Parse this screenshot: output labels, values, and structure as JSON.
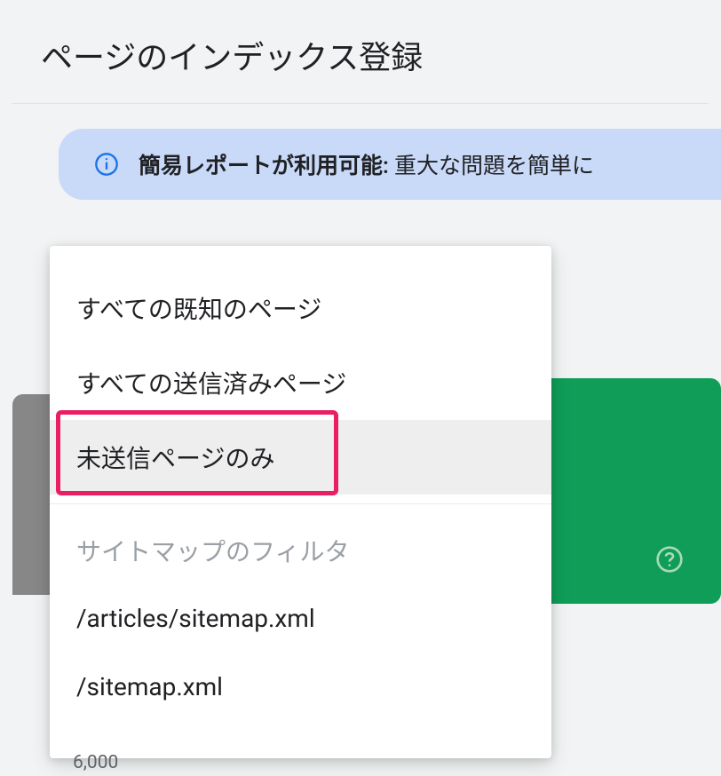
{
  "header": {
    "title": "ページのインデックス登録"
  },
  "banner": {
    "bold": "簡易レポートが利用可能:",
    "rest": " 重大な問題を簡単に"
  },
  "dropdown": {
    "items": [
      {
        "label": "すべての既知のページ",
        "selected": false
      },
      {
        "label": "すべての送信済みページ",
        "selected": false
      },
      {
        "label": "未送信ページのみ",
        "selected": true
      }
    ],
    "sectionLabel": "サイトマップのフィルタ",
    "sitemaps": [
      {
        "label": "/articles/sitemap.xml"
      },
      {
        "label": "/sitemap.xml"
      }
    ]
  },
  "chart": {
    "axisLabel": "6,000"
  },
  "colors": {
    "accentGreen": "#0f9d58",
    "highlightPink": "#e91e63",
    "bannerBlue": "#c9d9f8",
    "infoIconBlue": "#1a73e8"
  }
}
